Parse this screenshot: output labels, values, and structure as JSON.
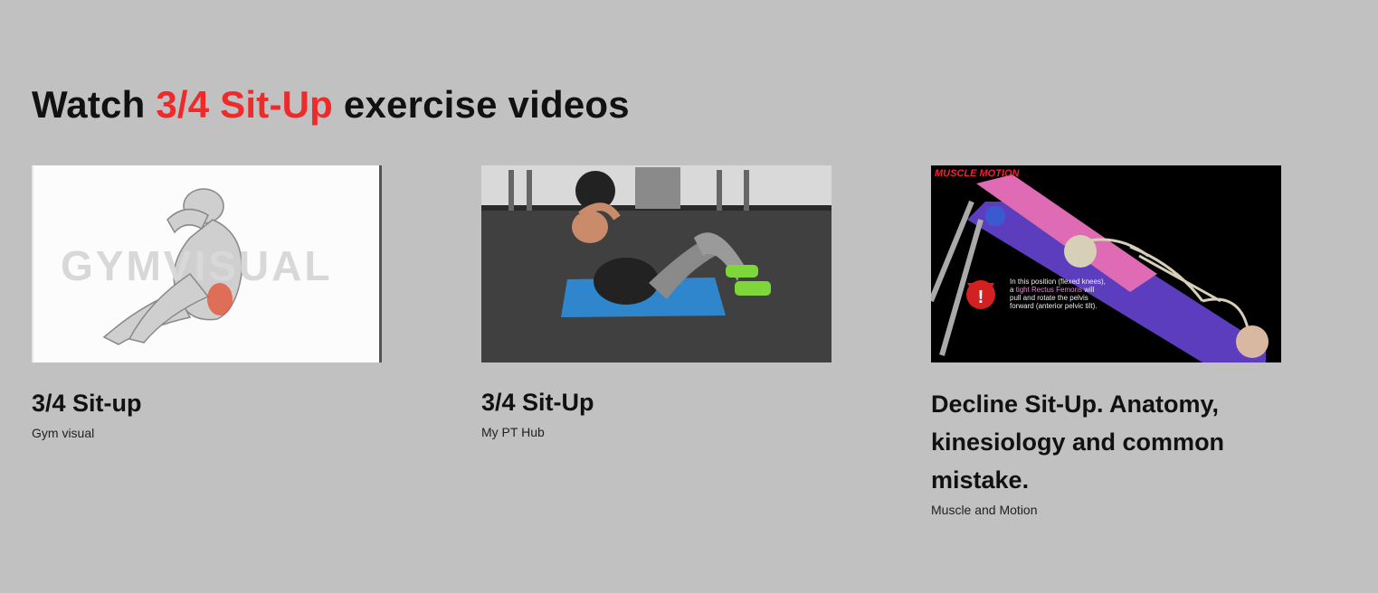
{
  "heading": {
    "prefix": "Watch",
    "highlight": "3/4 Sit-Up",
    "suffix": "exercise videos"
  },
  "videos": [
    {
      "title": "3/4 Sit-up",
      "channel": "Gym visual",
      "watermark": "GYMVISUAL"
    },
    {
      "title": "3/4 Sit-Up",
      "channel": "My PT Hub"
    },
    {
      "title": "Decline Sit-Up. Anatomy, kinesiology and common mistake.",
      "channel": "Muscle and Motion",
      "logo": "MUSCLE MOTION",
      "overlay": {
        "line1": "In this position (flexed knees),",
        "line2a": "a",
        "line2b": "tight Rectus Femoris",
        "line2c": "will",
        "line3": "pull and rotate the pelvis",
        "line4": "forward (anterior pelvic tilt)."
      }
    }
  ],
  "colors": {
    "background": "#c1c1c1",
    "accent": "#ee2a2a",
    "text": "#111111"
  }
}
